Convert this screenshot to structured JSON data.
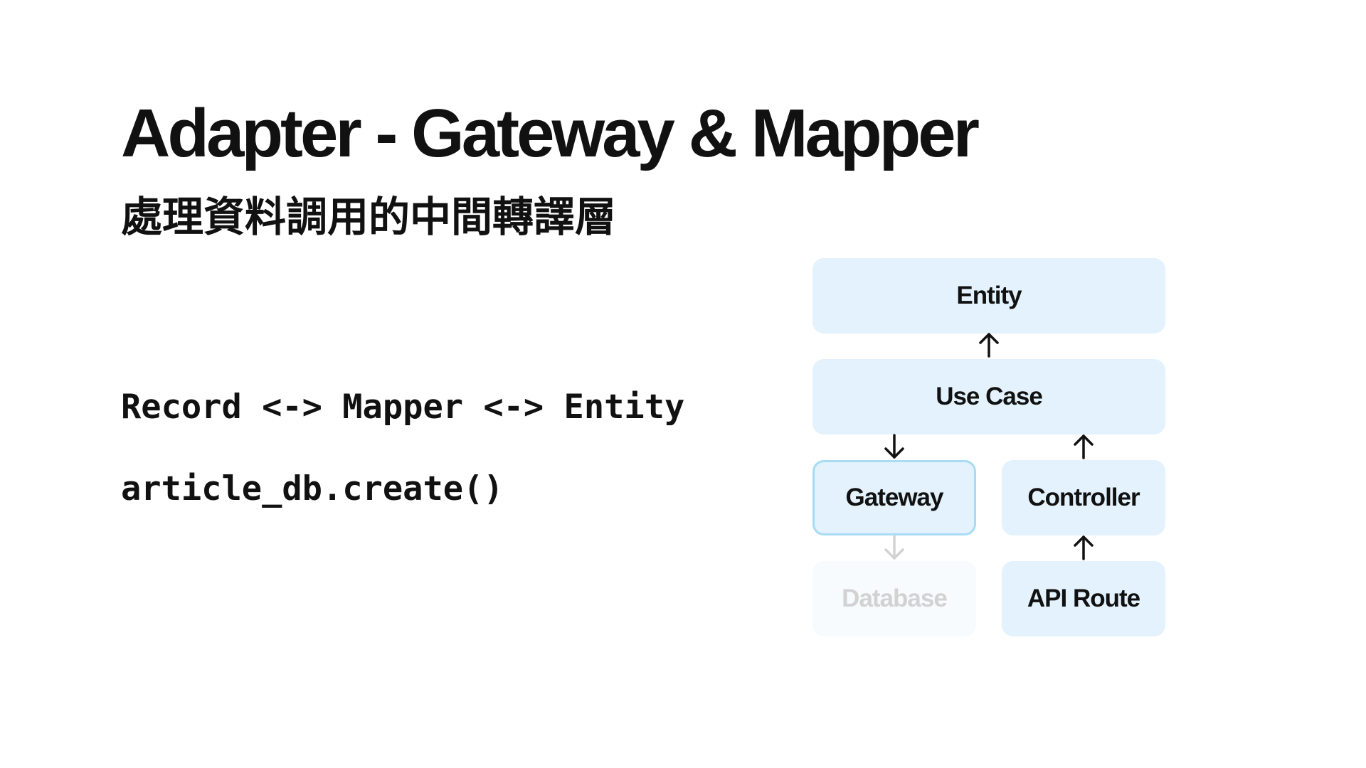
{
  "slide": {
    "title": "Adapter - Gateway & Mapper",
    "subtitle": "處理資料調用的中間轉譯層",
    "code_lines": [
      "Record <-> Mapper <-> Entity",
      "article_db.create()"
    ]
  },
  "diagram": {
    "nodes": {
      "entity": "Entity",
      "use_case": "Use Case",
      "gateway": "Gateway",
      "controller": "Controller",
      "database": "Database",
      "api_route": "API Route"
    },
    "arrows": [
      {
        "from": "use_case",
        "to": "entity",
        "icon": "arrow-up-icon"
      },
      {
        "from": "use_case",
        "to": "gateway",
        "icon": "arrow-down-icon"
      },
      {
        "from": "controller",
        "to": "use_case",
        "icon": "arrow-up-icon"
      },
      {
        "from": "gateway",
        "to": "database",
        "icon": "arrow-down-icon",
        "faded": true
      },
      {
        "from": "api_route",
        "to": "controller",
        "icon": "arrow-up-icon"
      }
    ],
    "colors": {
      "box_fill": "#e3f2fc",
      "highlight_border": "#a8dcf5",
      "faded_fill": "#f7fbfe",
      "faded_text": "#d2d2d2",
      "arrow": "#111111",
      "faded_arrow": "#d2d2d2"
    }
  }
}
